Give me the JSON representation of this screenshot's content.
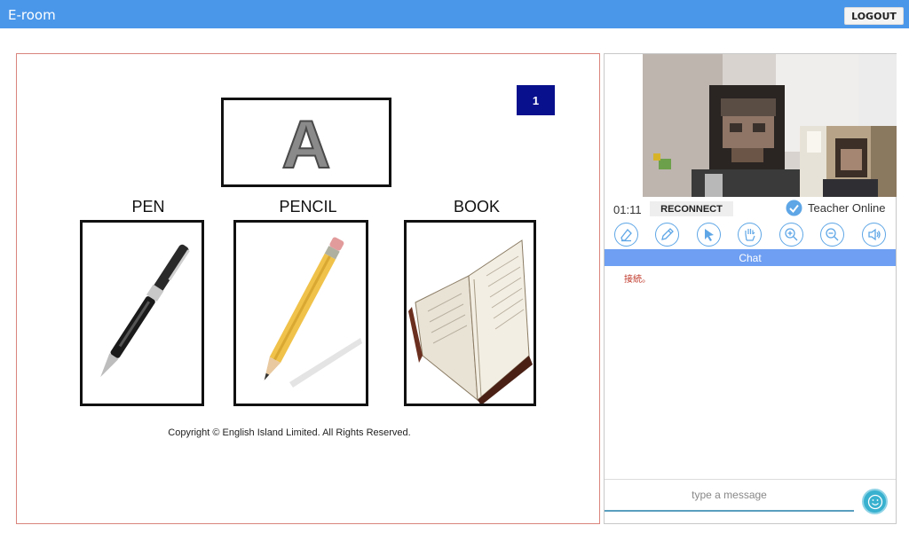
{
  "app": {
    "title": "E-room",
    "logout_label": "LOGOUT"
  },
  "board": {
    "letter": "A",
    "page_number": "1",
    "cards": [
      {
        "word": "PEN",
        "image": "pen-image"
      },
      {
        "word": "PENCIL",
        "image": "pencil-image"
      },
      {
        "word": "BOOK",
        "image": "book-image"
      }
    ],
    "copyright": "Copyright © English Island Limited. All Rights Reserved."
  },
  "session": {
    "timer": "01:11",
    "reconnect_label": "RECONNECT",
    "status": "Teacher Online"
  },
  "tools": [
    "eraser-icon",
    "pen-tool-icon",
    "pointer-icon",
    "hand-icon",
    "zoom-in-icon",
    "zoom-out-icon",
    "speaker-icon"
  ],
  "chat": {
    "header": "Chat",
    "messages": [
      "接続。"
    ],
    "placeholder": "type a message"
  },
  "colors": {
    "topbar": "#4a97ea",
    "accent": "#6e9ff2",
    "badge": "#08108d"
  }
}
